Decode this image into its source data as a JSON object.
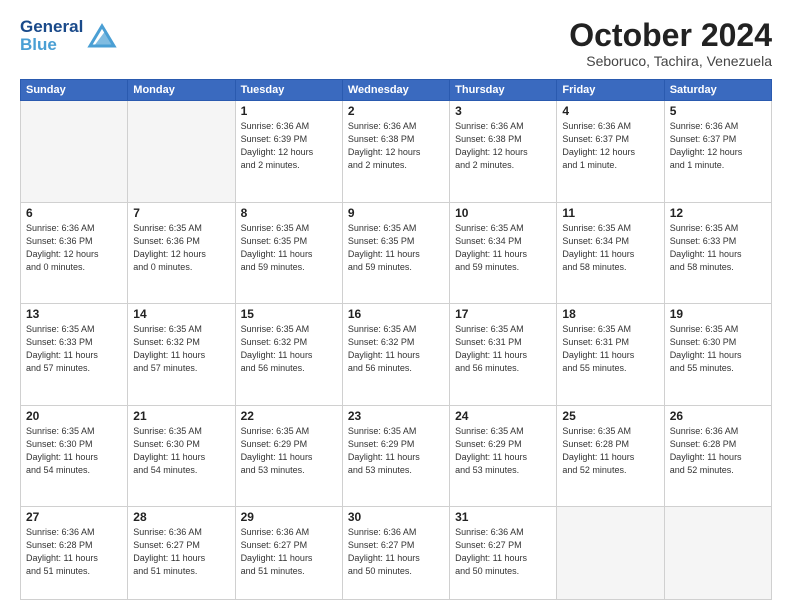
{
  "logo": {
    "line1": "General",
    "line2": "Blue"
  },
  "title": "October 2024",
  "subtitle": "Seboruco, Tachira, Venezuela",
  "weekdays": [
    "Sunday",
    "Monday",
    "Tuesday",
    "Wednesday",
    "Thursday",
    "Friday",
    "Saturday"
  ],
  "weeks": [
    [
      {
        "day": "",
        "info": ""
      },
      {
        "day": "",
        "info": ""
      },
      {
        "day": "1",
        "info": "Sunrise: 6:36 AM\nSunset: 6:39 PM\nDaylight: 12 hours\nand 2 minutes."
      },
      {
        "day": "2",
        "info": "Sunrise: 6:36 AM\nSunset: 6:38 PM\nDaylight: 12 hours\nand 2 minutes."
      },
      {
        "day": "3",
        "info": "Sunrise: 6:36 AM\nSunset: 6:38 PM\nDaylight: 12 hours\nand 2 minutes."
      },
      {
        "day": "4",
        "info": "Sunrise: 6:36 AM\nSunset: 6:37 PM\nDaylight: 12 hours\nand 1 minute."
      },
      {
        "day": "5",
        "info": "Sunrise: 6:36 AM\nSunset: 6:37 PM\nDaylight: 12 hours\nand 1 minute."
      }
    ],
    [
      {
        "day": "6",
        "info": "Sunrise: 6:36 AM\nSunset: 6:36 PM\nDaylight: 12 hours\nand 0 minutes."
      },
      {
        "day": "7",
        "info": "Sunrise: 6:35 AM\nSunset: 6:36 PM\nDaylight: 12 hours\nand 0 minutes."
      },
      {
        "day": "8",
        "info": "Sunrise: 6:35 AM\nSunset: 6:35 PM\nDaylight: 11 hours\nand 59 minutes."
      },
      {
        "day": "9",
        "info": "Sunrise: 6:35 AM\nSunset: 6:35 PM\nDaylight: 11 hours\nand 59 minutes."
      },
      {
        "day": "10",
        "info": "Sunrise: 6:35 AM\nSunset: 6:34 PM\nDaylight: 11 hours\nand 59 minutes."
      },
      {
        "day": "11",
        "info": "Sunrise: 6:35 AM\nSunset: 6:34 PM\nDaylight: 11 hours\nand 58 minutes."
      },
      {
        "day": "12",
        "info": "Sunrise: 6:35 AM\nSunset: 6:33 PM\nDaylight: 11 hours\nand 58 minutes."
      }
    ],
    [
      {
        "day": "13",
        "info": "Sunrise: 6:35 AM\nSunset: 6:33 PM\nDaylight: 11 hours\nand 57 minutes."
      },
      {
        "day": "14",
        "info": "Sunrise: 6:35 AM\nSunset: 6:32 PM\nDaylight: 11 hours\nand 57 minutes."
      },
      {
        "day": "15",
        "info": "Sunrise: 6:35 AM\nSunset: 6:32 PM\nDaylight: 11 hours\nand 56 minutes."
      },
      {
        "day": "16",
        "info": "Sunrise: 6:35 AM\nSunset: 6:32 PM\nDaylight: 11 hours\nand 56 minutes."
      },
      {
        "day": "17",
        "info": "Sunrise: 6:35 AM\nSunset: 6:31 PM\nDaylight: 11 hours\nand 56 minutes."
      },
      {
        "day": "18",
        "info": "Sunrise: 6:35 AM\nSunset: 6:31 PM\nDaylight: 11 hours\nand 55 minutes."
      },
      {
        "day": "19",
        "info": "Sunrise: 6:35 AM\nSunset: 6:30 PM\nDaylight: 11 hours\nand 55 minutes."
      }
    ],
    [
      {
        "day": "20",
        "info": "Sunrise: 6:35 AM\nSunset: 6:30 PM\nDaylight: 11 hours\nand 54 minutes."
      },
      {
        "day": "21",
        "info": "Sunrise: 6:35 AM\nSunset: 6:30 PM\nDaylight: 11 hours\nand 54 minutes."
      },
      {
        "day": "22",
        "info": "Sunrise: 6:35 AM\nSunset: 6:29 PM\nDaylight: 11 hours\nand 53 minutes."
      },
      {
        "day": "23",
        "info": "Sunrise: 6:35 AM\nSunset: 6:29 PM\nDaylight: 11 hours\nand 53 minutes."
      },
      {
        "day": "24",
        "info": "Sunrise: 6:35 AM\nSunset: 6:29 PM\nDaylight: 11 hours\nand 53 minutes."
      },
      {
        "day": "25",
        "info": "Sunrise: 6:35 AM\nSunset: 6:28 PM\nDaylight: 11 hours\nand 52 minutes."
      },
      {
        "day": "26",
        "info": "Sunrise: 6:36 AM\nSunset: 6:28 PM\nDaylight: 11 hours\nand 52 minutes."
      }
    ],
    [
      {
        "day": "27",
        "info": "Sunrise: 6:36 AM\nSunset: 6:28 PM\nDaylight: 11 hours\nand 51 minutes."
      },
      {
        "day": "28",
        "info": "Sunrise: 6:36 AM\nSunset: 6:27 PM\nDaylight: 11 hours\nand 51 minutes."
      },
      {
        "day": "29",
        "info": "Sunrise: 6:36 AM\nSunset: 6:27 PM\nDaylight: 11 hours\nand 51 minutes."
      },
      {
        "day": "30",
        "info": "Sunrise: 6:36 AM\nSunset: 6:27 PM\nDaylight: 11 hours\nand 50 minutes."
      },
      {
        "day": "31",
        "info": "Sunrise: 6:36 AM\nSunset: 6:27 PM\nDaylight: 11 hours\nand 50 minutes."
      },
      {
        "day": "",
        "info": ""
      },
      {
        "day": "",
        "info": ""
      }
    ]
  ]
}
